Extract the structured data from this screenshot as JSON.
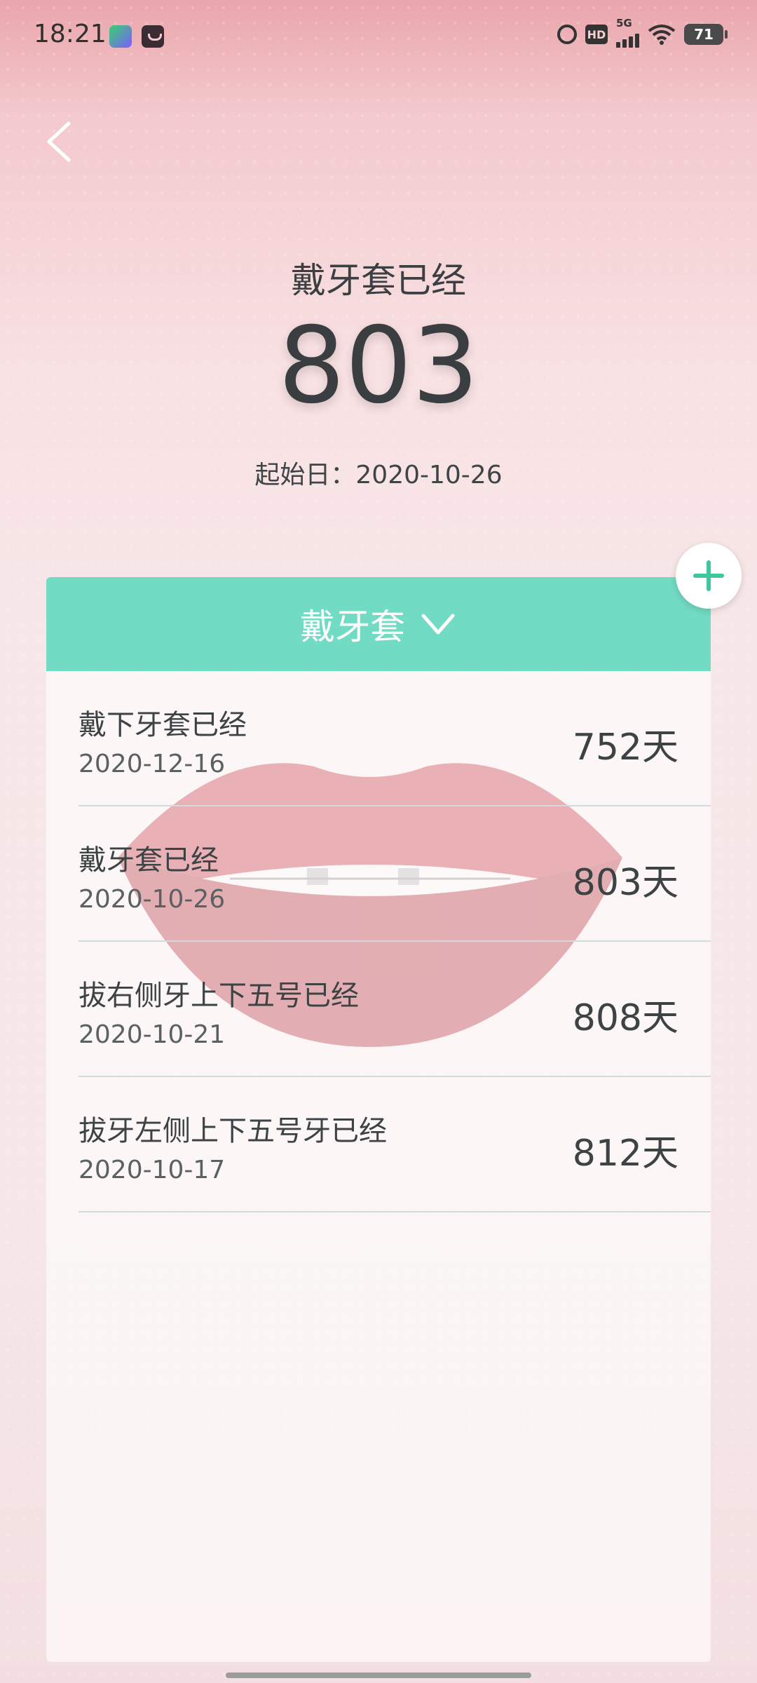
{
  "status_bar": {
    "time": "18:21",
    "app_icons": [
      "iqiyi-app-icon",
      "shopping-bag-app-icon"
    ],
    "hd_label": "HD",
    "network_label": "5G",
    "battery_level": "71"
  },
  "header": {
    "title": "戴牙套已经",
    "count": "803",
    "start_date": "起始日：2020-10-26"
  },
  "card": {
    "category_title": "戴牙套"
  },
  "events": [
    {
      "name": "戴下牙套已经",
      "date": "2020-12-16",
      "days": "752天"
    },
    {
      "name": "戴牙套已经",
      "date": "2020-10-26",
      "days": "803天"
    },
    {
      "name": "拔右侧牙上下五号已经",
      "date": "2020-10-21",
      "days": "808天"
    },
    {
      "name": "拔牙左侧上下五号牙已经",
      "date": "2020-10-17",
      "days": "812天"
    }
  ],
  "colors": {
    "accent": "#72dbc3",
    "add_icon": "#3ec79f",
    "background_top": "#e9a5ab",
    "background": "#f7e7e8"
  },
  "icons": [
    "back-chevron-icon",
    "plus-icon",
    "chevron-down-icon",
    "alarm-icon",
    "wifi-icon",
    "battery-icon"
  ]
}
